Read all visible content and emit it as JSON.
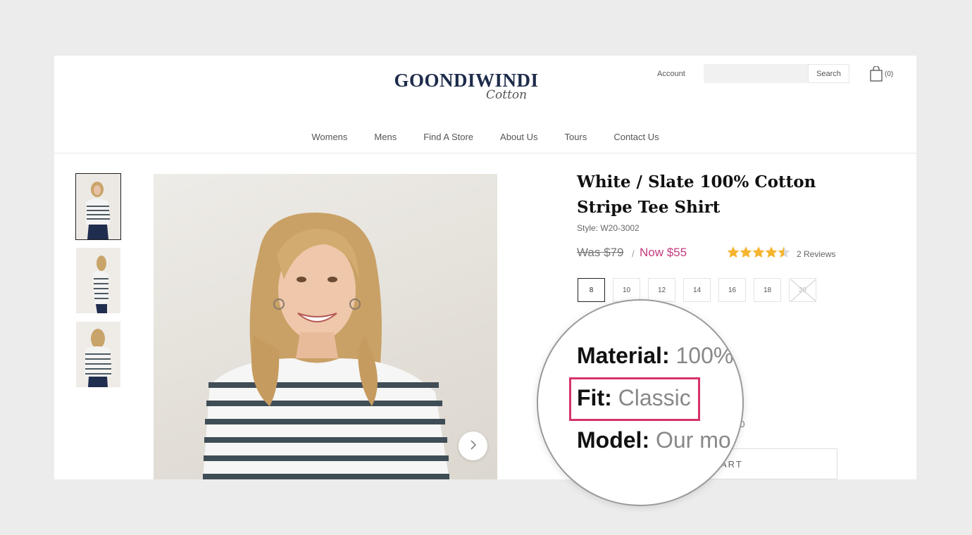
{
  "header": {
    "logo_main": "GOONDIWINDI",
    "logo_script": "Cotton",
    "account_label": "Account",
    "search_placeholder": "",
    "search_button": "Search",
    "cart_count": "(0)"
  },
  "nav": {
    "items": [
      "Womens",
      "Mens",
      "Find A Store",
      "About Us",
      "Tours",
      "Contact Us"
    ]
  },
  "gallery": {
    "thumbnails": [
      "front view",
      "side view",
      "back view"
    ],
    "active_index": 0,
    "next_icon": "chevron-right-icon"
  },
  "product": {
    "title": "White / Slate 100% Cotton Stripe Tee Shirt",
    "style": "Style: W20-3002",
    "price_was": "Was $79",
    "price_separator": "/",
    "price_now": "Now $55",
    "rating": 4.5,
    "reviews": "2 Reviews",
    "sizes": [
      {
        "label": "8",
        "state": "selected"
      },
      {
        "label": "10",
        "state": "available"
      },
      {
        "label": "12",
        "state": "available"
      },
      {
        "label": "14",
        "state": "available"
      },
      {
        "label": "16",
        "state": "available"
      },
      {
        "label": "18",
        "state": "available"
      },
      {
        "label": "20",
        "state": "soldout"
      }
    ],
    "size_model_fragment": "10",
    "add_to_cart_fragment": "ART"
  },
  "magnifier": {
    "material_label": "Material:",
    "material_value": "100%",
    "fit_label": "Fit:",
    "fit_value": "Classic",
    "model_label": "Model:",
    "model_value": "Our mo"
  },
  "colors": {
    "page_bg": "#ececec",
    "brand_navy": "#1d2b4a",
    "sale_price": "#c43a7d",
    "highlight": "#d6336c",
    "star": "#f5b531"
  }
}
